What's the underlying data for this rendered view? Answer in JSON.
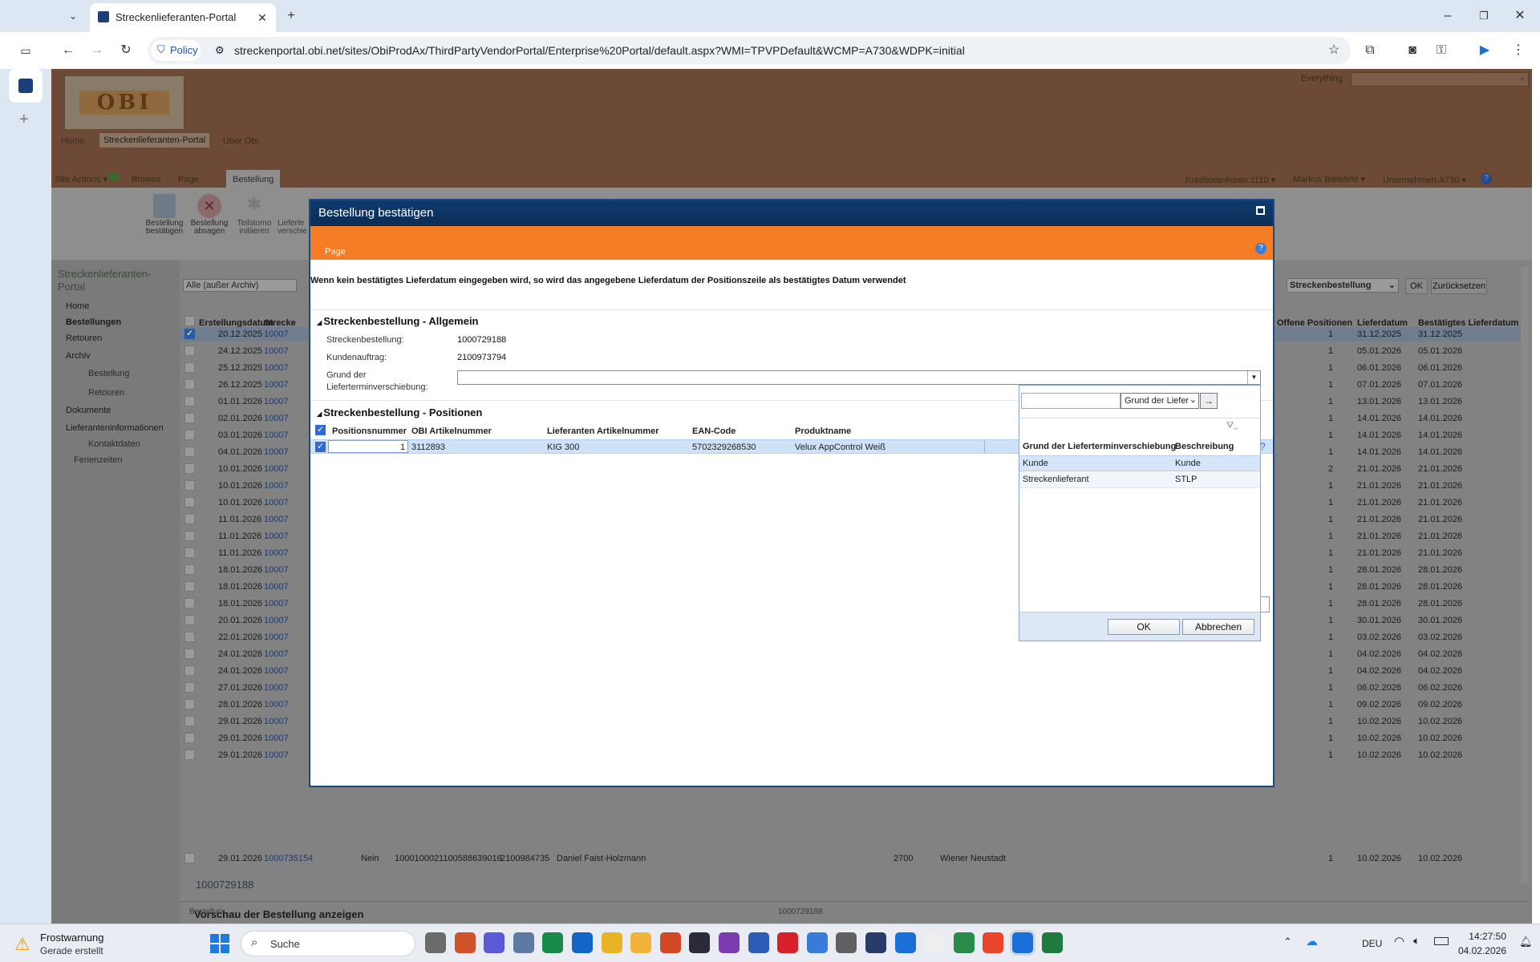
{
  "browser": {
    "tab_title": "Streckenlieferanten-Portal",
    "policy_label": "Policy",
    "url": "streckenportal.obi.net/sites/ObiProdAx/ThirdPartyVendorPortal/Enterprise%20Portal/default.aspx?WMI=TPVPDefault&WCMP=A730&WDPK=initial"
  },
  "site": {
    "logo": "OBI",
    "search_label": "Everything",
    "nav": [
      "Home",
      "Streckenlieferanten-Portal",
      "Über Obi"
    ],
    "ribbon_tabs": [
      "Site Actions ▾",
      "Browse",
      "Page",
      "Bestellung"
    ],
    "user_info": [
      "Kreditorenkonto:1110 ▾",
      "Markus Bielefeld ▾",
      "Unternehmen:A730 ▾"
    ],
    "ribbon_buttons": [
      "Bestellung bestätigen",
      "Bestellung absagen",
      "Teilstorno initiieren",
      "Lieferte verschie"
    ],
    "leftnav": {
      "title": "Streckenlieferanten-Portal",
      "items": [
        "Home",
        "Bestellungen",
        "Retouren",
        "Archiv",
        "Bestellung",
        "Retouren",
        "Dokumente",
        "Lieferanteninformationen",
        "Kontaktdaten",
        "Ferienzeiten"
      ]
    },
    "filter_value": "Alle (außer Archiv)",
    "view_select": "Streckenbestellung",
    "ok_label": "OK",
    "reset_label": "Zurücksetzen",
    "grid_headers": [
      "Erstellungsdatum",
      "Strecke",
      "Offene Positionen",
      "Lieferdatum",
      "Bestätigtes Lieferdatum"
    ],
    "grid_rows": [
      [
        "20.12.2025",
        "10007",
        "1",
        "31.12.2025",
        "31.12.2025"
      ],
      [
        "24.12.2025",
        "10007",
        "1",
        "05.01.2026",
        "05.01.2026"
      ],
      [
        "25.12.2025",
        "10007",
        "1",
        "06.01.2026",
        "06.01.2026"
      ],
      [
        "26.12.2025",
        "10007",
        "1",
        "07.01.2026",
        "07.01.2026"
      ],
      [
        "01.01.2026",
        "10007",
        "1",
        "13.01.2026",
        "13.01.2026"
      ],
      [
        "02.01.2026",
        "10007",
        "1",
        "14.01.2026",
        "14.01.2026"
      ],
      [
        "03.01.2026",
        "10007",
        "1",
        "14.01.2026",
        "14.01.2026"
      ],
      [
        "04.01.2026",
        "10007",
        "1",
        "14.01.2026",
        "14.01.2026"
      ],
      [
        "10.01.2026",
        "10007",
        "2",
        "21.01.2026",
        "21.01.2026"
      ],
      [
        "10.01.2026",
        "10007",
        "1",
        "21.01.2026",
        "21.01.2026"
      ],
      [
        "10.01.2026",
        "10007",
        "1",
        "21.01.2026",
        "21.01.2026"
      ],
      [
        "11.01.2026",
        "10007",
        "1",
        "21.01.2026",
        "21.01.2026"
      ],
      [
        "11.01.2026",
        "10007",
        "1",
        "21.01.2026",
        "21.01.2026"
      ],
      [
        "11.01.2026",
        "10007",
        "1",
        "21.01.2026",
        "21.01.2026"
      ],
      [
        "18.01.2026",
        "10007",
        "1",
        "28.01.2026",
        "28.01.2026"
      ],
      [
        "18.01.2026",
        "10007",
        "1",
        "28.01.2026",
        "28.01.2026"
      ],
      [
        "18.01.2026",
        "10007",
        "1",
        "28.01.2026",
        "28.01.2026"
      ],
      [
        "20.01.2026",
        "10007",
        "1",
        "30.01.2026",
        "30.01.2026"
      ],
      [
        "22.01.2026",
        "10007",
        "1",
        "03.02.2026",
        "03.02.2026"
      ],
      [
        "24.01.2026",
        "10007",
        "1",
        "04.02.2026",
        "04.02.2026"
      ],
      [
        "24.01.2026",
        "10007",
        "1",
        "04.02.2026",
        "04.02.2026"
      ],
      [
        "27.01.2026",
        "10007",
        "1",
        "06.02.2026",
        "06.02.2026"
      ],
      [
        "28.01.2026",
        "10007",
        "1",
        "09.02.2026",
        "09.02.2026"
      ],
      [
        "29.01.2026",
        "10007",
        "1",
        "10.02.2026",
        "10.02.2026"
      ],
      [
        "29.01.2026",
        "10007",
        "1",
        "10.02.2026",
        "10.02.2026"
      ],
      [
        "29.01.2026",
        "10007",
        "1",
        "10.02.2026",
        "10.02.2026"
      ]
    ],
    "last_row": {
      "date": "29.01.2026",
      "order": "1000735154",
      "flag": "Nein",
      "code": "1000100021100588639016",
      "num": "2100984735",
      "name": "Daniel Faist-Holzmann",
      "zip": "2700",
      "city": "Wiener Neustadt",
      "open": "1",
      "delivery": "10.02.2026",
      "confirmed": "10.02.2026"
    },
    "preview_label": "Vorschau der Bestellung anzeigen",
    "preview_number": "1000729188",
    "preview_sub_left": "Bestellun",
    "preview_sub_right": "1000729188"
  },
  "dialog": {
    "title": "Bestellung bestätigen",
    "band_label": "Page",
    "notice": "Wenn kein bestätigtes Lieferdatum eingegeben wird, so wird das angegebene Lieferdatum der Positionszeile als bestätigtes Datum verwendet",
    "sec1": "Streckenbestellung - Allgemein",
    "f1_label": "Streckenbestellung:",
    "f1_value": "1000729188",
    "f2_label": "Kundenauftrag:",
    "f2_value": "2100973794",
    "f3_label_a": "Grund der",
    "f3_label_b": "Lieferterminverschiebung:",
    "sec2": "Streckenbestellung - Positionen",
    "pos_headers": [
      "Positionsnummer",
      "OBI Artikelnummer",
      "Lieferanten Artikelnummer",
      "EAN-Code",
      "Produktname"
    ],
    "pos_row": [
      "1",
      "3112893",
      "KIG 300",
      "5702329268530",
      "Velux AppControl Weiß"
    ]
  },
  "lookup": {
    "filter_select": "Grund der Liefer",
    "headers": [
      "Grund der Lieferterminverschiebung",
      "Beschreibung"
    ],
    "rows": [
      [
        "Kunde",
        "Kunde"
      ],
      [
        "Streckenlieferant",
        "STLP"
      ]
    ],
    "ok": "OK",
    "cancel": "Abbrechen"
  },
  "taskbar": {
    "weather_title": "Frostwarnung",
    "weather_sub": "Gerade erstellt",
    "search": "Suche",
    "lang": "DEU",
    "time": "14:27:50",
    "date": "04.02.2026"
  }
}
